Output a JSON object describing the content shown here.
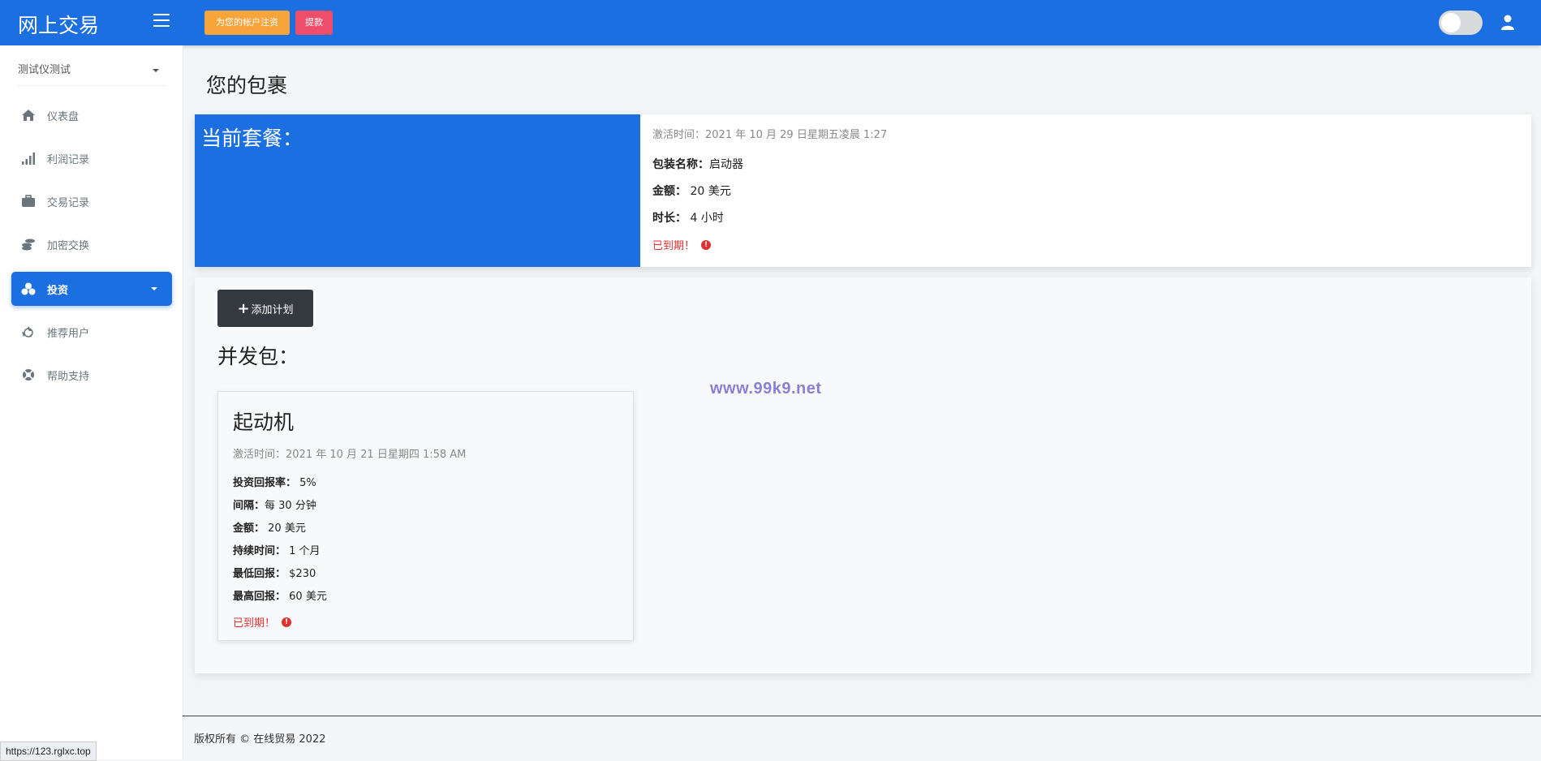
{
  "topbar": {
    "brand": "网上交易",
    "fund_button": "为您的帐户注资",
    "withdraw_button": "提款"
  },
  "sidebar": {
    "user_name": "测试仪测试",
    "items": [
      {
        "label": "仪表盘",
        "icon": "home-icon"
      },
      {
        "label": "利润记录",
        "icon": "signal-bars-icon"
      },
      {
        "label": "交易记录",
        "icon": "briefcase-icon"
      },
      {
        "label": "加密交换",
        "icon": "coins-icon"
      },
      {
        "label": "投资",
        "icon": "cubes-icon"
      },
      {
        "label": "推荐用户",
        "icon": "recycle-icon"
      },
      {
        "label": "帮助支持",
        "icon": "lifebuoy-icon"
      }
    ]
  },
  "page": {
    "title": "您的包裹"
  },
  "current": {
    "title": "当前套餐：",
    "activated": "激活时间：2021 年 10 月 29 日星期五凌晨 1:27",
    "package_label": "包装名称：",
    "package_value": "启动器",
    "amount_label": "金额：",
    "amount_value": "20 美元",
    "duration_label": "时长：",
    "duration_value": "4 小时",
    "expired": "已到期！"
  },
  "plans": {
    "add_button": "添加计划",
    "title": "并发包：",
    "items": [
      {
        "name": "起动机",
        "activated": "激活时间：2021 年 10 月 21 日星期四 1:58 AM",
        "roi_label": "投资回报率：",
        "roi_value": "5%",
        "interval_label": "间隔：",
        "interval_value": "每 30 分钟",
        "amount_label": "金额：",
        "amount_value": "20 美元",
        "duration_label": "持续时间：",
        "duration_value": "1 个月",
        "min_label": "最低回报：",
        "min_value": "$230",
        "max_label": "最高回报：",
        "max_value": "60 美元",
        "expired": "已到期！"
      }
    ]
  },
  "watermark": "www.99k9.net",
  "footer": {
    "text": "版权所有 © 在线贸易 2022"
  },
  "statusbar": {
    "url": "https://123.rglxc.top"
  },
  "colors": {
    "primary": "#1b6fe0",
    "fund": "#f7a53a",
    "withdraw": "#ee4e6a",
    "expired": "#e03131"
  }
}
